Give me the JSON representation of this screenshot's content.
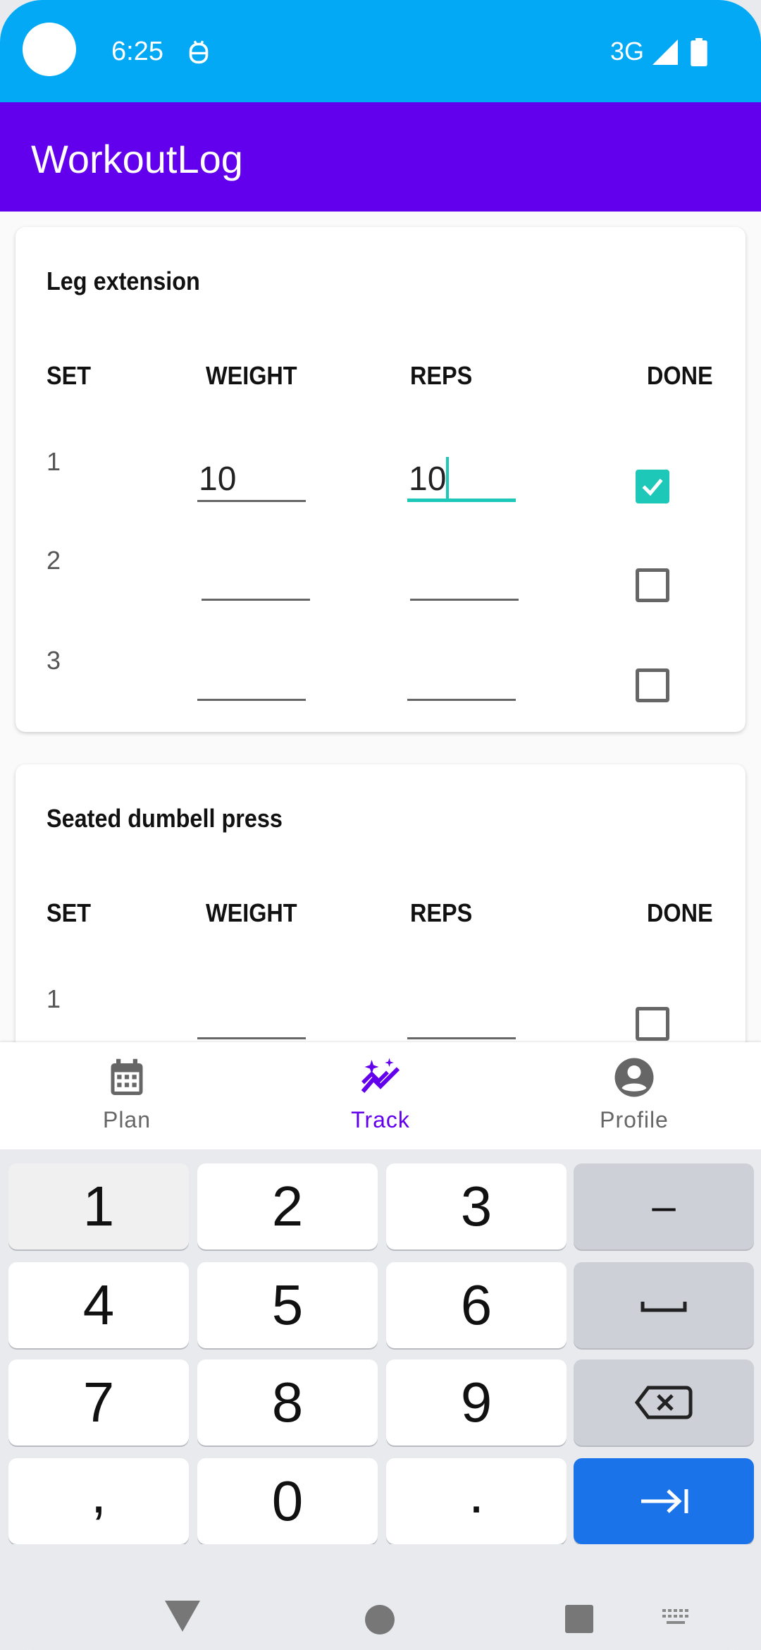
{
  "status_bar": {
    "time": "6:25",
    "network": "3G",
    "icons": [
      "notification-icon",
      "signal-icon",
      "battery-icon"
    ]
  },
  "app_bar": {
    "title": "WorkoutLog"
  },
  "columns": {
    "set": "SET",
    "weight": "WEIGHT",
    "reps": "REPS",
    "done": "DONE"
  },
  "exercises": [
    {
      "name": "Leg extension",
      "sets": [
        {
          "set": "1",
          "weight": "10",
          "reps": "10",
          "done": true
        },
        {
          "set": "2",
          "weight": "",
          "reps": "",
          "done": false
        },
        {
          "set": "3",
          "weight": "",
          "reps": "",
          "done": false
        }
      ]
    },
    {
      "name": "Seated dumbell press",
      "sets": [
        {
          "set": "1",
          "weight": "",
          "reps": "",
          "done": false
        }
      ]
    }
  ],
  "bottom_nav": {
    "items": [
      {
        "label": "Plan",
        "icon": "calendar-icon"
      },
      {
        "label": "Track",
        "icon": "sparkle-chart-icon",
        "active": true
      },
      {
        "label": "Profile",
        "icon": "account-circle-icon"
      }
    ]
  },
  "keyboard": {
    "keys": [
      "1",
      "2",
      "3",
      "–",
      "4",
      "5",
      "6",
      "␣",
      "7",
      "8",
      "9",
      "⌫",
      ",",
      "0",
      ".",
      "⇥"
    ],
    "icons": [
      "space-icon",
      "backspace-icon",
      "next-icon"
    ]
  },
  "colors": {
    "status_bar": "#03a9f4",
    "app_bar": "#6200ee",
    "accent": "#1dc8b8",
    "active_nav": "#6200ee",
    "action_key": "#1a73e8"
  }
}
